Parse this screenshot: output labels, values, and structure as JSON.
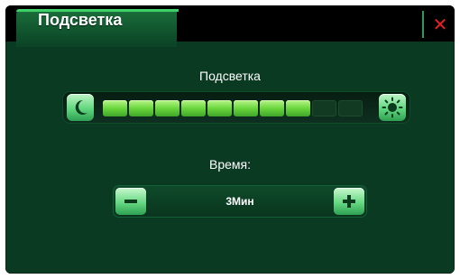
{
  "header": {
    "title": "Подсветка",
    "close_glyph": "✕",
    "tab_color": "#1f7a42",
    "close_color": "#e8202a"
  },
  "brightness": {
    "label": "Подсветка",
    "level": 8,
    "max": 10,
    "min_icon": "moon-icon",
    "max_icon": "sun-icon"
  },
  "timer": {
    "label": "Время:",
    "value": "3Мин",
    "decrease_icon": "minus-icon",
    "increase_icon": "plus-icon"
  },
  "colors": {
    "background": "#0a3a21",
    "segment_on": "#6ad63c",
    "segment_off": "#123a22"
  }
}
